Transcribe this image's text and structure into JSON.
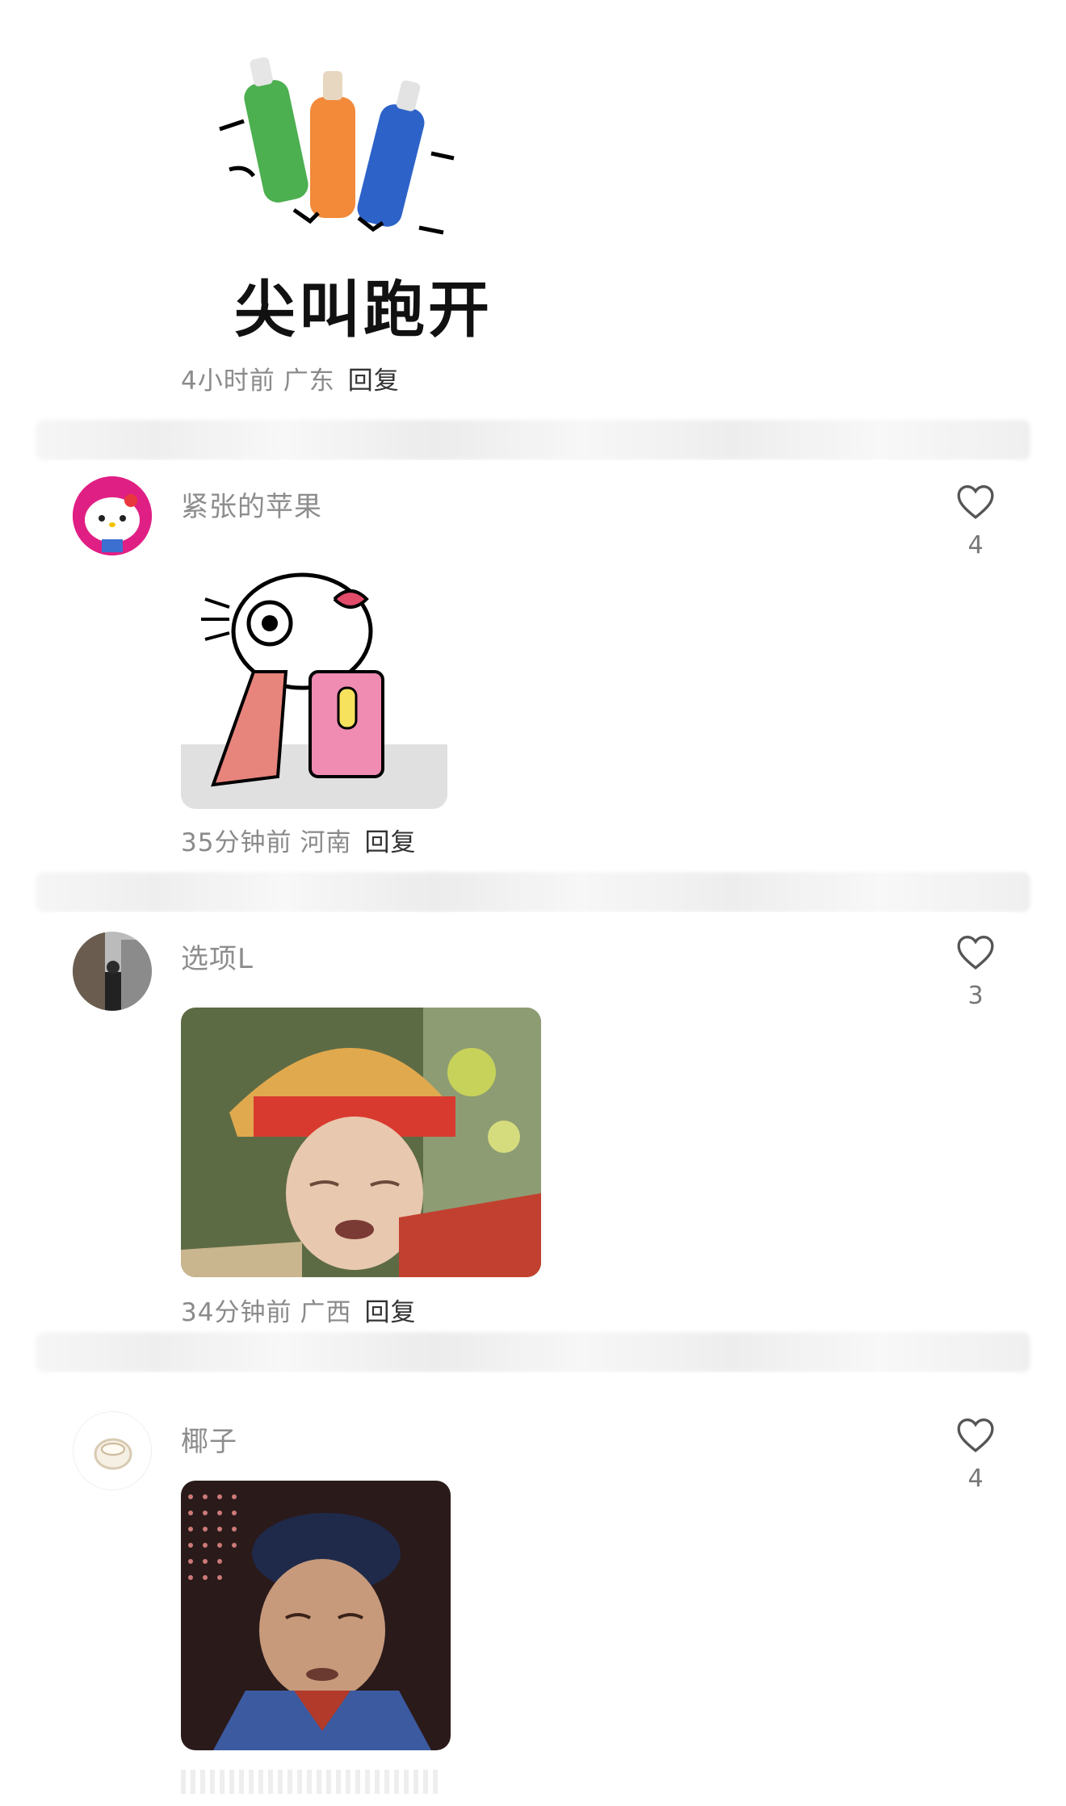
{
  "comments": [
    {
      "sticker_caption": "尖叫跑开",
      "time": "4小时前",
      "location": "广东",
      "reply_label": "回复"
    },
    {
      "username": "紧张的苹果",
      "likes": "4",
      "time": "35分钟前",
      "location": "河南",
      "reply_label": "回复"
    },
    {
      "username": "选项L",
      "likes": "3",
      "time": "34分钟前",
      "location": "广西",
      "reply_label": "回复"
    },
    {
      "username": "椰子",
      "likes": "4"
    }
  ],
  "icons": {
    "like": "heart-outline-icon"
  },
  "colors": {
    "meta": "#8a8a8a",
    "username": "#8d8d8d",
    "reply": "#333333",
    "heart": "#555555"
  }
}
